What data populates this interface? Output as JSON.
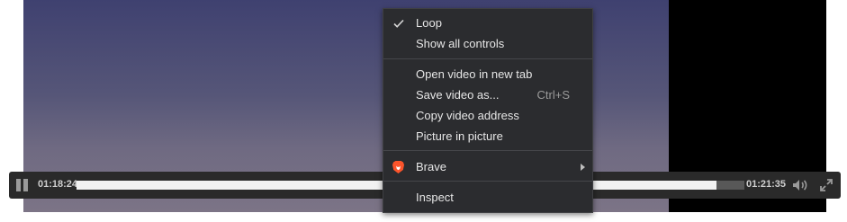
{
  "player": {
    "current_time": "01:18:24",
    "total_time": "01:21:35",
    "progress": 0.958,
    "icons": [
      "pause-icon",
      "volume-icon",
      "fullscreen-icon"
    ]
  },
  "context_menu": {
    "loop": "Loop",
    "loop_checked": true,
    "show_all_controls": "Show all controls",
    "open_video_new_tab": "Open video in new tab",
    "save_video_as": "Save video as...",
    "save_video_shortcut": "Ctrl+S",
    "copy_video_address": "Copy video address",
    "picture_in_picture": "Picture in picture",
    "brave": "Brave",
    "inspect": "Inspect"
  },
  "colors": {
    "menu_bg": "#2b2c2f",
    "brave_orange": "#fb542b",
    "controls_bg": "#2a2a2a"
  }
}
